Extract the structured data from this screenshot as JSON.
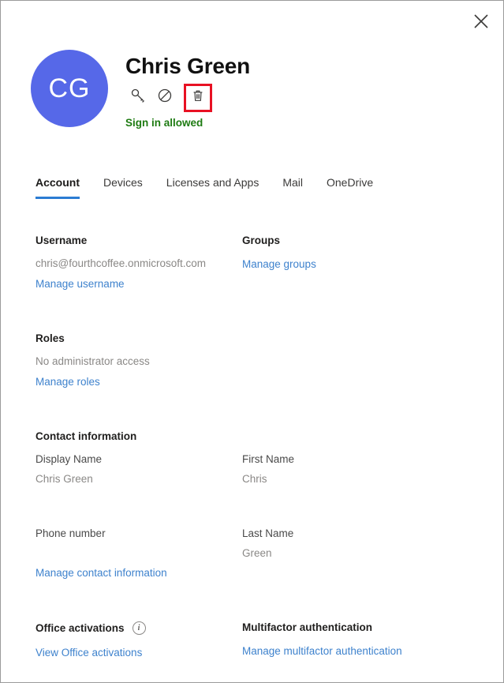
{
  "panel": {
    "close_label": "Close"
  },
  "header": {
    "avatar_initials": "CG",
    "avatar_color": "#5668e8",
    "user_name": "Chris Green",
    "signin_status": "Sign in allowed",
    "signin_status_color": "#1e7b12",
    "highlight_color": "#e81123",
    "actions": [
      {
        "icon": "key-icon",
        "label": "Reset password",
        "highlighted": false
      },
      {
        "icon": "block-icon",
        "label": "Block sign-in",
        "highlighted": false
      },
      {
        "icon": "trash-icon",
        "label": "Delete user",
        "highlighted": true
      }
    ]
  },
  "tabs": {
    "active_color": "#2b7cd3",
    "items": [
      {
        "label": "Account",
        "active": true
      },
      {
        "label": "Devices",
        "active": false
      },
      {
        "label": "Licenses and Apps",
        "active": false
      },
      {
        "label": "Mail",
        "active": false
      },
      {
        "label": "OneDrive",
        "active": false
      }
    ]
  },
  "link_color": "#3e82cd",
  "sections": {
    "username": {
      "title": "Username",
      "value": "chris@fourthcoffee.onmicrosoft.com",
      "link": "Manage username"
    },
    "groups": {
      "title": "Groups",
      "link": "Manage groups"
    },
    "roles": {
      "title": "Roles",
      "value": "No administrator access",
      "link": "Manage roles"
    },
    "contact": {
      "title": "Contact information",
      "display_name_label": "Display Name",
      "display_name_value": "Chris Green",
      "first_name_label": "First Name",
      "first_name_value": "Chris",
      "phone_label": "Phone number",
      "phone_value": "",
      "last_name_label": "Last Name",
      "last_name_value": "Green",
      "link": "Manage contact information"
    },
    "office_activations": {
      "title": "Office activations",
      "info_icon": "info-icon",
      "link": "View Office activations"
    },
    "mfa": {
      "title": "Multifactor authentication",
      "link": "Manage multifactor authentication"
    }
  }
}
